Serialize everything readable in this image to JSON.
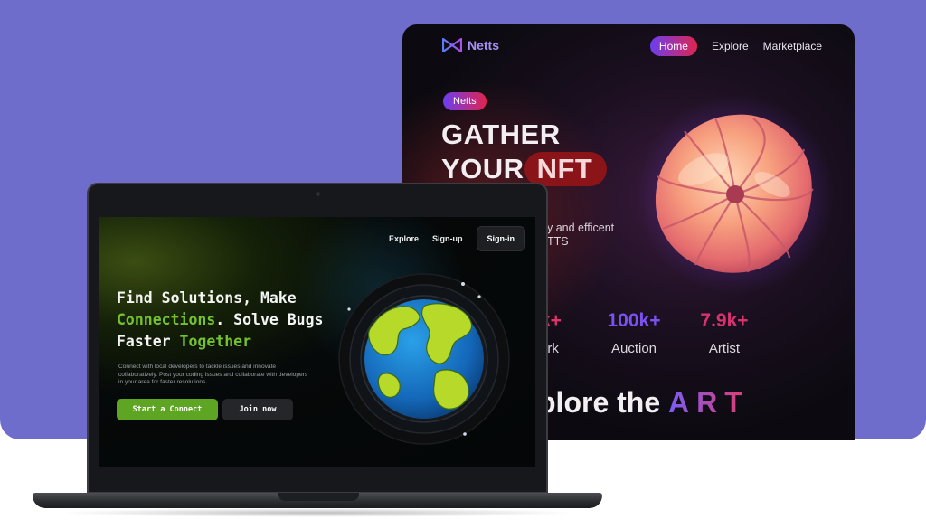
{
  "nft_site": {
    "logo": {
      "icon": "bowtie-logo-icon",
      "text": "Netts"
    },
    "nav": {
      "home": "Home",
      "explore": "Explore",
      "marketplace": "Marketplace"
    },
    "badge": "Netts",
    "headline": {
      "line1": "GATHER",
      "line2_plain": "YOUR",
      "line2_pill": "NFT"
    },
    "description": {
      "line1": "y and efficent",
      "line2": "TTS"
    },
    "stats": [
      {
        "value": "k+",
        "label": "ork",
        "color": "#e0336b"
      },
      {
        "value": "100k+",
        "label": "Auction",
        "color": "#7b52f2"
      },
      {
        "value": "7.9k+",
        "label": "Artist",
        "color": "#d8336f"
      }
    ],
    "explore": {
      "text": "plore the",
      "highlight": "ART"
    }
  },
  "dev_site": {
    "nav": {
      "explore": "Explore",
      "signup": "Sign-up",
      "signin": "Sign-in"
    },
    "headline": {
      "l1": "Find Solutions, Make",
      "l2_green": "Connections",
      "l2_rest": ". Solve Bugs",
      "l3_plain": "Faster ",
      "l3_green": "Together"
    },
    "description": "Connect with local developers to tackle issues and innovate collaboratively. Post your coding issues and collaborate with developers in your area for faster resolutions.",
    "buttons": {
      "start": "Start a Connect",
      "join": "Join now"
    }
  },
  "colors": {
    "background_panel": "#6f6dcb",
    "accent_green": "#74c22e",
    "nft_gradient_start": "#6c3ef0",
    "nft_gradient_end": "#e0244f"
  }
}
